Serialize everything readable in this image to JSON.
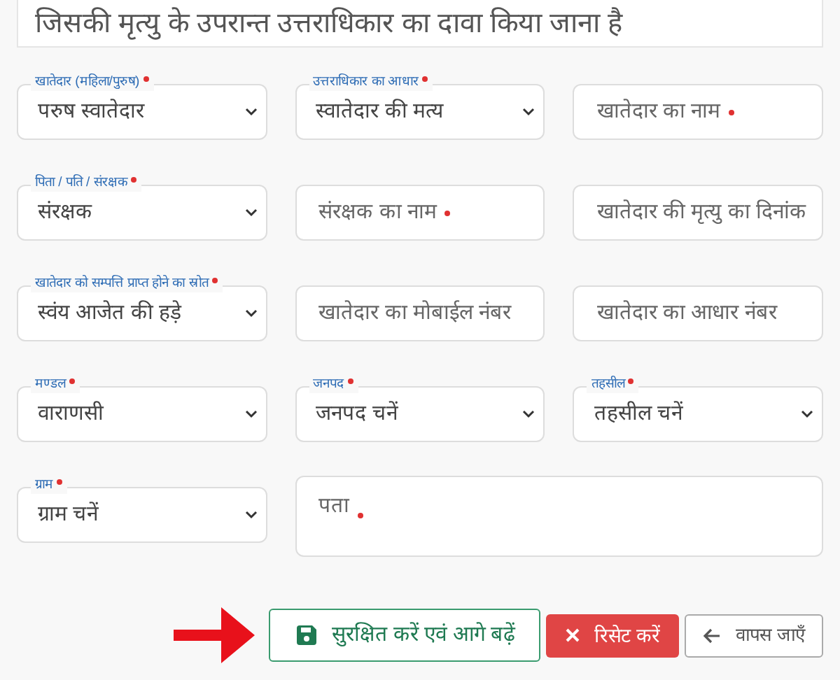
{
  "heading": "जिसकी मृत्यु के उपरान्त उत्तराधिकार का दावा किया जाना है",
  "fields": [
    {
      "kind": "select",
      "label": "खातेदार (महिला/पुरुष)",
      "required": true,
      "value": "परुष स्वातेदार"
    },
    {
      "kind": "select",
      "label": "उत्तराधिकार का आधार",
      "required": true,
      "value": "स्वातेदार की मत्य"
    },
    {
      "kind": "input",
      "placeholder": "खातेदार का नाम",
      "required": true
    },
    {
      "kind": "select",
      "label": "पिता / पति / संरक्षक",
      "required": true,
      "value": "संरक्षक"
    },
    {
      "kind": "input",
      "placeholder": "संरक्षक का नाम",
      "required": true
    },
    {
      "kind": "input",
      "placeholder": "खातेदार की मृत्यु का दिनांक",
      "required": false
    },
    {
      "kind": "select",
      "label": "खातेदार को सम्पत्ति प्राप्त होने का स्रोत",
      "required": true,
      "value": "स्वंय आजेत की हड़े"
    },
    {
      "kind": "input",
      "placeholder": "खातेदार का मोबाईल नंबर",
      "required": false
    },
    {
      "kind": "input",
      "placeholder": "खातेदार का आधार नंबर",
      "required": false
    },
    {
      "kind": "select",
      "label": "मण्डल",
      "required": true,
      "value": "वाराणसी"
    },
    {
      "kind": "select",
      "label": "जनपद",
      "required": true,
      "value": "जनपद चनें"
    },
    {
      "kind": "select",
      "label": "तहसील",
      "required": true,
      "value": "तहसील चनें"
    },
    {
      "kind": "select",
      "label": "ग्राम",
      "required": true,
      "value": "ग्राम चनें"
    },
    {
      "kind": "textarea",
      "placeholder": "पता",
      "required": true
    }
  ],
  "buttons": [
    {
      "kind": "save",
      "label": "सुरक्षित करें एवं आगे बढ़ें"
    },
    {
      "kind": "reset",
      "label": "रिसेट करें"
    },
    {
      "kind": "back",
      "label": "वापस जाएँ"
    }
  ]
}
